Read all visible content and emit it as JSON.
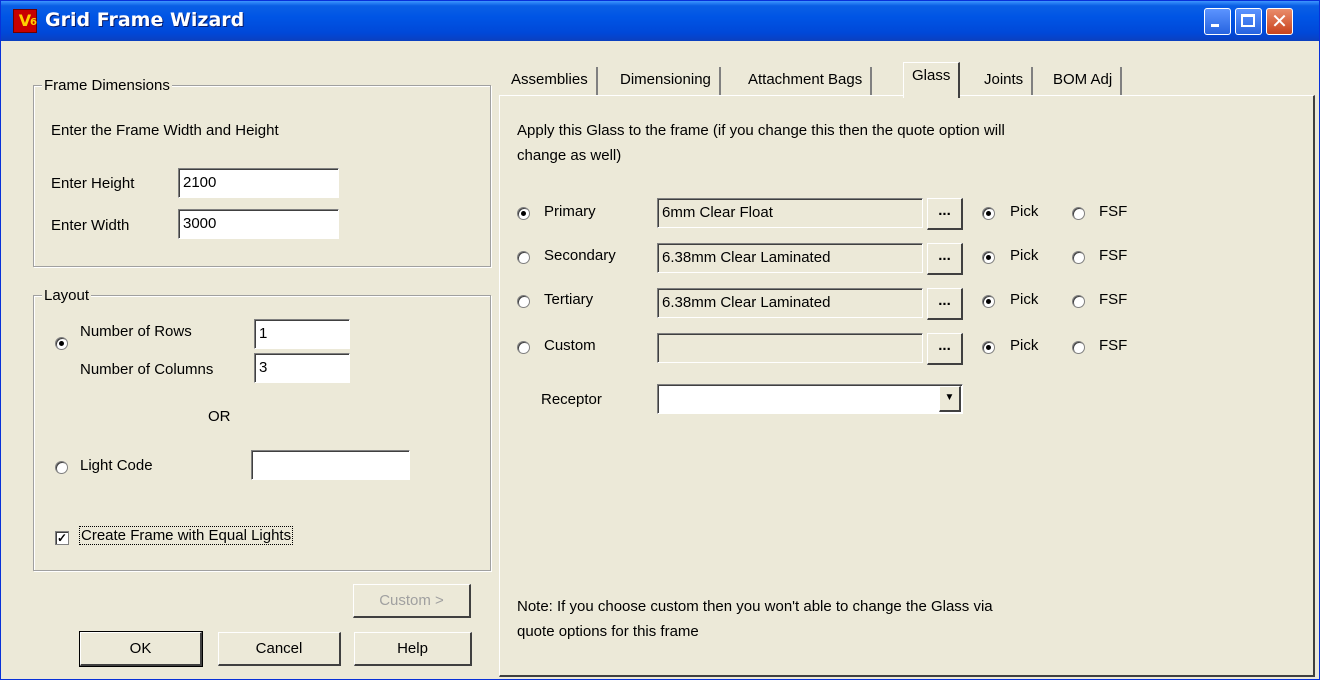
{
  "window": {
    "title": "Grid Frame Wizard",
    "app_icon": "V",
    "app_icon_sub": "6"
  },
  "frame_dimensions": {
    "legend": "Frame Dimensions",
    "instruction": "Enter the Frame Width and Height",
    "height_label": "Enter Height",
    "height_value": "2100",
    "width_label": "Enter Width",
    "width_value": "3000"
  },
  "layout": {
    "legend": "Layout",
    "rows_label": "Number of Rows",
    "rows_value": "1",
    "columns_label": "Number of Columns",
    "columns_value": "3",
    "or_label": "OR",
    "light_code_label": "Light Code",
    "light_code_value": "",
    "equal_lights_label": "Create Frame with Equal Lights",
    "equal_lights_checked": true,
    "selected": "rows_columns"
  },
  "buttons": {
    "custom": "Custom >",
    "ok": "OK",
    "cancel": "Cancel",
    "help": "Help"
  },
  "tabs": [
    "Assemblies",
    "Dimensioning",
    "Attachment Bags",
    "Glass",
    "Joints",
    "BOM Adj"
  ],
  "active_tab": "Glass",
  "glass": {
    "intro_line1": "Apply this Glass to the frame (if you change this then the quote option will",
    "intro_line2": "change as well)",
    "rows": [
      {
        "label": "Primary",
        "value": "6mm Clear Float",
        "selected": true,
        "pick": "Pick",
        "fsf": "FSF"
      },
      {
        "label": "Secondary",
        "value": "6.38mm Clear Laminated",
        "selected": false,
        "pick": "Pick",
        "fsf": "FSF"
      },
      {
        "label": "Tertiary",
        "value": "6.38mm Clear Laminated",
        "selected": false,
        "pick": "Pick",
        "fsf": "FSF"
      },
      {
        "label": "Custom",
        "value": "",
        "selected": false,
        "pick": "Pick",
        "fsf": "FSF"
      }
    ],
    "browse_label": "...",
    "receptor_label": "Receptor",
    "receptor_value": "",
    "note_line1": "Note: If you choose custom then you won't able to change the Glass via",
    "note_line2": "quote options for this frame"
  }
}
